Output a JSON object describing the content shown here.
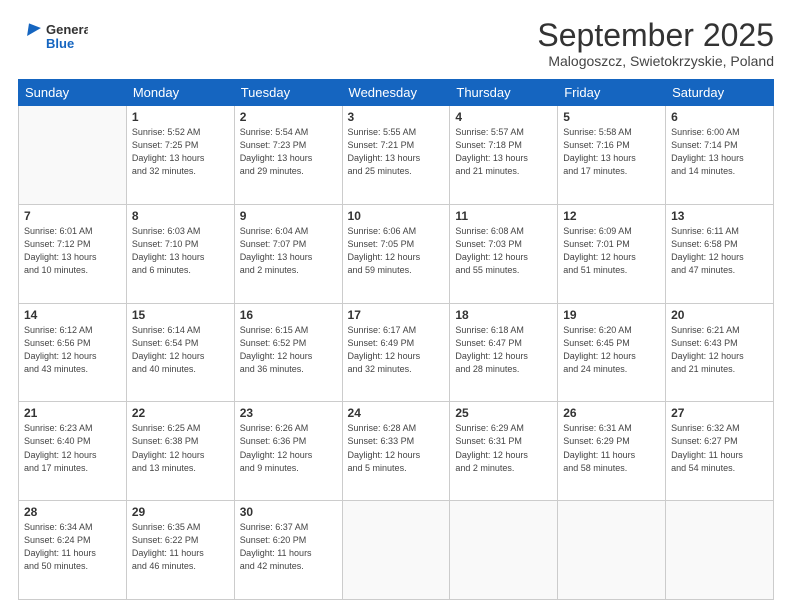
{
  "header": {
    "logo": {
      "line1": "General",
      "line2": "Blue"
    },
    "title": "September 2025",
    "location": "Malogoszcz, Swietokrzyskie, Poland"
  },
  "weekdays": [
    "Sunday",
    "Monday",
    "Tuesday",
    "Wednesday",
    "Thursday",
    "Friday",
    "Saturday"
  ],
  "weeks": [
    [
      {
        "day": "",
        "info": ""
      },
      {
        "day": "1",
        "info": "Sunrise: 5:52 AM\nSunset: 7:25 PM\nDaylight: 13 hours\nand 32 minutes."
      },
      {
        "day": "2",
        "info": "Sunrise: 5:54 AM\nSunset: 7:23 PM\nDaylight: 13 hours\nand 29 minutes."
      },
      {
        "day": "3",
        "info": "Sunrise: 5:55 AM\nSunset: 7:21 PM\nDaylight: 13 hours\nand 25 minutes."
      },
      {
        "day": "4",
        "info": "Sunrise: 5:57 AM\nSunset: 7:18 PM\nDaylight: 13 hours\nand 21 minutes."
      },
      {
        "day": "5",
        "info": "Sunrise: 5:58 AM\nSunset: 7:16 PM\nDaylight: 13 hours\nand 17 minutes."
      },
      {
        "day": "6",
        "info": "Sunrise: 6:00 AM\nSunset: 7:14 PM\nDaylight: 13 hours\nand 14 minutes."
      }
    ],
    [
      {
        "day": "7",
        "info": "Sunrise: 6:01 AM\nSunset: 7:12 PM\nDaylight: 13 hours\nand 10 minutes."
      },
      {
        "day": "8",
        "info": "Sunrise: 6:03 AM\nSunset: 7:10 PM\nDaylight: 13 hours\nand 6 minutes."
      },
      {
        "day": "9",
        "info": "Sunrise: 6:04 AM\nSunset: 7:07 PM\nDaylight: 13 hours\nand 2 minutes."
      },
      {
        "day": "10",
        "info": "Sunrise: 6:06 AM\nSunset: 7:05 PM\nDaylight: 12 hours\nand 59 minutes."
      },
      {
        "day": "11",
        "info": "Sunrise: 6:08 AM\nSunset: 7:03 PM\nDaylight: 12 hours\nand 55 minutes."
      },
      {
        "day": "12",
        "info": "Sunrise: 6:09 AM\nSunset: 7:01 PM\nDaylight: 12 hours\nand 51 minutes."
      },
      {
        "day": "13",
        "info": "Sunrise: 6:11 AM\nSunset: 6:58 PM\nDaylight: 12 hours\nand 47 minutes."
      }
    ],
    [
      {
        "day": "14",
        "info": "Sunrise: 6:12 AM\nSunset: 6:56 PM\nDaylight: 12 hours\nand 43 minutes."
      },
      {
        "day": "15",
        "info": "Sunrise: 6:14 AM\nSunset: 6:54 PM\nDaylight: 12 hours\nand 40 minutes."
      },
      {
        "day": "16",
        "info": "Sunrise: 6:15 AM\nSunset: 6:52 PM\nDaylight: 12 hours\nand 36 minutes."
      },
      {
        "day": "17",
        "info": "Sunrise: 6:17 AM\nSunset: 6:49 PM\nDaylight: 12 hours\nand 32 minutes."
      },
      {
        "day": "18",
        "info": "Sunrise: 6:18 AM\nSunset: 6:47 PM\nDaylight: 12 hours\nand 28 minutes."
      },
      {
        "day": "19",
        "info": "Sunrise: 6:20 AM\nSunset: 6:45 PM\nDaylight: 12 hours\nand 24 minutes."
      },
      {
        "day": "20",
        "info": "Sunrise: 6:21 AM\nSunset: 6:43 PM\nDaylight: 12 hours\nand 21 minutes."
      }
    ],
    [
      {
        "day": "21",
        "info": "Sunrise: 6:23 AM\nSunset: 6:40 PM\nDaylight: 12 hours\nand 17 minutes."
      },
      {
        "day": "22",
        "info": "Sunrise: 6:25 AM\nSunset: 6:38 PM\nDaylight: 12 hours\nand 13 minutes."
      },
      {
        "day": "23",
        "info": "Sunrise: 6:26 AM\nSunset: 6:36 PM\nDaylight: 12 hours\nand 9 minutes."
      },
      {
        "day": "24",
        "info": "Sunrise: 6:28 AM\nSunset: 6:33 PM\nDaylight: 12 hours\nand 5 minutes."
      },
      {
        "day": "25",
        "info": "Sunrise: 6:29 AM\nSunset: 6:31 PM\nDaylight: 12 hours\nand 2 minutes."
      },
      {
        "day": "26",
        "info": "Sunrise: 6:31 AM\nSunset: 6:29 PM\nDaylight: 11 hours\nand 58 minutes."
      },
      {
        "day": "27",
        "info": "Sunrise: 6:32 AM\nSunset: 6:27 PM\nDaylight: 11 hours\nand 54 minutes."
      }
    ],
    [
      {
        "day": "28",
        "info": "Sunrise: 6:34 AM\nSunset: 6:24 PM\nDaylight: 11 hours\nand 50 minutes."
      },
      {
        "day": "29",
        "info": "Sunrise: 6:35 AM\nSunset: 6:22 PM\nDaylight: 11 hours\nand 46 minutes."
      },
      {
        "day": "30",
        "info": "Sunrise: 6:37 AM\nSunset: 6:20 PM\nDaylight: 11 hours\nand 42 minutes."
      },
      {
        "day": "",
        "info": ""
      },
      {
        "day": "",
        "info": ""
      },
      {
        "day": "",
        "info": ""
      },
      {
        "day": "",
        "info": ""
      }
    ]
  ]
}
